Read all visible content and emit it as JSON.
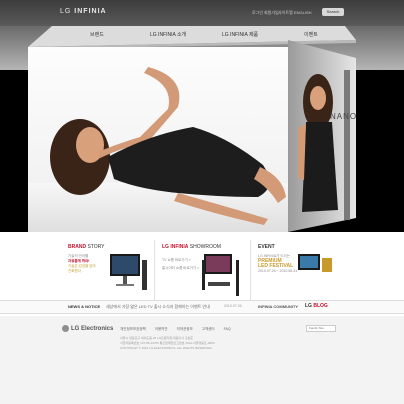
{
  "header": {
    "logo_prefix": "LG",
    "logo_brand": "INFINIA",
    "util_links": [
      "로그인",
      "회원가입",
      "사이트맵",
      "ENGLISH"
    ],
    "search_label": "Search"
  },
  "nav": {
    "items": [
      "브랜드",
      "LG INFINIA 소개",
      "LG INFINIA 제품",
      "이벤트"
    ]
  },
  "hero": {
    "side_text": "NANO"
  },
  "brand_story": {
    "title_strong": "BRAND",
    "title_rest": " STORY",
    "line1": "기술의 언어를",
    "line2": "자유롭게 하라!",
    "line3": "기술은 감성을 담아",
    "line4": "진화한다"
  },
  "showroom": {
    "title_strong": "LG INFINIA",
    "title_rest": " SHOWROOM",
    "item1": "TV 쇼룸 바로가기 >",
    "item2": "홈시어터 쇼룸 바로가기 >"
  },
  "event": {
    "title": "EVENT",
    "line1": "LG INFINIA가 드리는",
    "line2": "PREMIUM",
    "line3": "LED FESTIVAL",
    "dates": "2010.07.26 ~ 2010.08.31"
  },
  "news": {
    "label": "NEWS & NOTICE",
    "text": "세상에서 가장 얇은 LED TV 출시 소식과 함께하는 이벤트 안내",
    "date": "2010.07.26",
    "community": "INFINIA COMMUNITY",
    "blog_prefix": "LG",
    "blog": "BLOG"
  },
  "footer": {
    "logo": "LG Electronics",
    "links": [
      "개인정보보호정책",
      "이용약관",
      "저작권정보",
      "고객센터",
      "FAQ"
    ],
    "info_lines": [
      "서울시 영등포구 여의도동 20 LG트윈타워 대표이사 구본준",
      "사업자등록번호 107-86-14075 통신판매업신고번호 2010-서울영등포-0000",
      "COPYRIGHT © 2010 LG ELECTRONICS. ALL RIGHTS RESERVED."
    ],
    "family_site": "Family Site"
  },
  "colors": {
    "accent": "#c4122f",
    "topbar": "#3c3c3c",
    "stage": "#000000"
  }
}
